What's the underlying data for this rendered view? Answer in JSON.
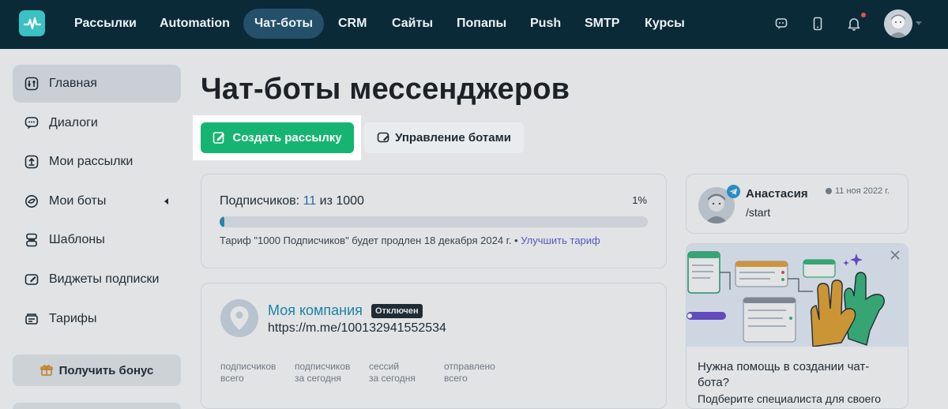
{
  "nav": {
    "items": [
      {
        "label": "Рассылки",
        "active": false
      },
      {
        "label": "Automation",
        "active": false
      },
      {
        "label": "Чат-боты",
        "active": true
      },
      {
        "label": "CRM",
        "active": false
      },
      {
        "label": "Сайты",
        "active": false
      },
      {
        "label": "Попапы",
        "active": false
      },
      {
        "label": "Push",
        "active": false
      },
      {
        "label": "SMTP",
        "active": false
      },
      {
        "label": "Курсы",
        "active": false
      }
    ],
    "icons": [
      "logo-icon",
      "chat-support-icon",
      "mobile-icon",
      "bell-icon",
      "user-avatar"
    ]
  },
  "sidebar": {
    "items": [
      {
        "label": "Главная",
        "icon": "home-dashboard-icon",
        "active": true
      },
      {
        "label": "Диалоги",
        "icon": "dialogs-icon"
      },
      {
        "label": "Мои рассылки",
        "icon": "upload-campaign-icon"
      },
      {
        "label": "Мои боты",
        "icon": "bot-icon"
      },
      {
        "label": "Шаблоны",
        "icon": "templates-icon"
      },
      {
        "label": "Виджеты подписки",
        "icon": "widget-icon"
      },
      {
        "label": "Тарифы",
        "icon": "tariffs-icon"
      }
    ],
    "bonus_label": "Получить бонус"
  },
  "main": {
    "title": "Чат-боты мессенджеров",
    "create_button": "Создать рассылку",
    "manage_button": "Управление ботами",
    "subscribers": {
      "label_prefix": "Подписчиков:",
      "count": "11",
      "label_mid": "из",
      "limit": "1000",
      "percent": "1%",
      "progress_fraction": 0.011,
      "tariff_text": "Тариф \"1000 Подписчиков\" будет продлен 18 декабря 2024 г. •",
      "upgrade_link": "Улучшить тариф"
    },
    "bot": {
      "name": "Моя компания",
      "status": "Отключен",
      "url": "https://m.me/100132941552534",
      "stats": [
        {
          "line1": "подписчиков",
          "line2": "всего"
        },
        {
          "line1": "подписчиков",
          "line2": "за сегодня"
        },
        {
          "line1": "сессий",
          "line2": "за сегодня"
        },
        {
          "line1": "отправлено",
          "line2": "всего"
        }
      ]
    }
  },
  "right": {
    "dialog": {
      "name": "Анастасия",
      "date": "11 ноя 2022 г.",
      "message": "/start"
    },
    "help": {
      "title": "Нужна помощь в создании чат-бота?",
      "subtitle": "Подберите специалиста для своего"
    }
  },
  "colors": {
    "topbar": "#0a2a38",
    "accent_green": "#16b471",
    "link": "#5b5fd6",
    "bot_name": "#1b8fb5"
  }
}
